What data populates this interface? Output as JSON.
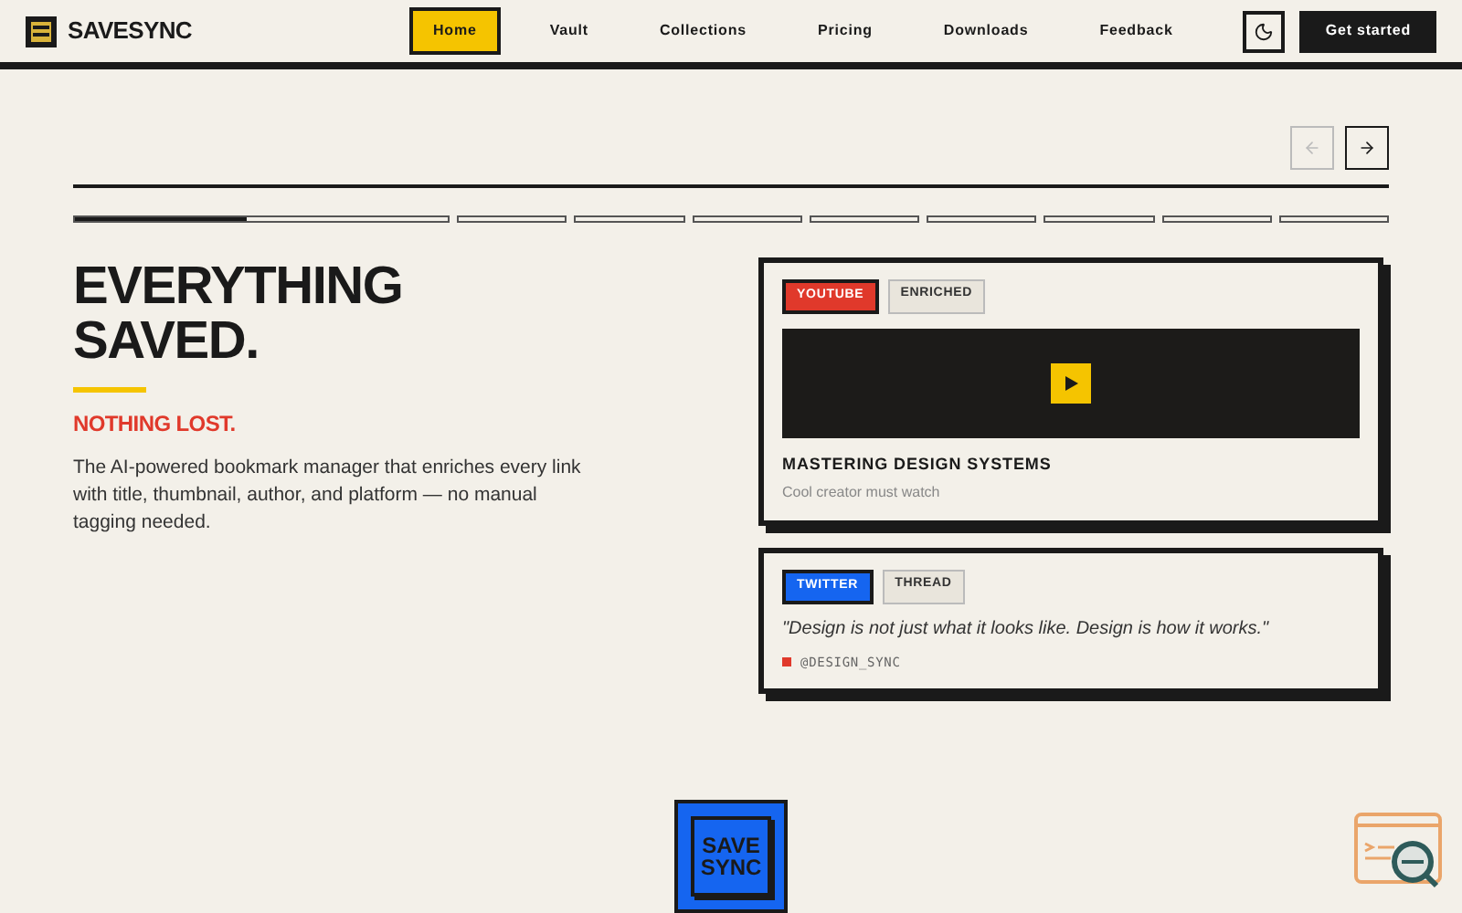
{
  "brand": {
    "name": "SAVESYNC"
  },
  "nav": [
    {
      "label": "Home",
      "selected": true
    },
    {
      "label": "Vault",
      "selected": false
    },
    {
      "label": "Collections",
      "selected": false
    },
    {
      "label": "Pricing",
      "selected": false
    },
    {
      "label": "Downloads",
      "selected": false
    },
    {
      "label": "Feedback",
      "selected": false
    }
  ],
  "cta": "Get started",
  "carousel": {
    "prev_disabled": true,
    "next_disabled": false,
    "segments": [
      {
        "level": 0.46
      },
      {
        "level": 0
      },
      {
        "level": 0
      },
      {
        "level": 0
      },
      {
        "level": 0
      },
      {
        "level": 0
      },
      {
        "level": 0
      },
      {
        "level": 0
      },
      {
        "level": 0
      }
    ]
  },
  "hero": {
    "title_lines": [
      "EVERYTHING",
      "SAVED."
    ],
    "subtitle": "NOTHING LOST.",
    "description": "The AI-powered bookmark manager that enriches every link with title, thumbnail, author, and platform — no manual tagging needed."
  },
  "cards": [
    {
      "kind": "video",
      "platform": {
        "label": "YOUTUBE",
        "color": "#e0392b"
      },
      "tag": "ENRICHED",
      "title": "MASTERING DESIGN SYSTEMS",
      "note": "Cool creator must watch"
    },
    {
      "kind": "quote",
      "platform": {
        "label": "TWITTER",
        "color": "#1565f0"
      },
      "tag": "THREAD",
      "quote": "\"Design is not just what it looks like. Design is how it works.\"",
      "author": {
        "handle": "@DESIGN_SYNC",
        "color": "#e0392b"
      }
    }
  ],
  "footer_logo": [
    "SAVE",
    "SYNC"
  ]
}
